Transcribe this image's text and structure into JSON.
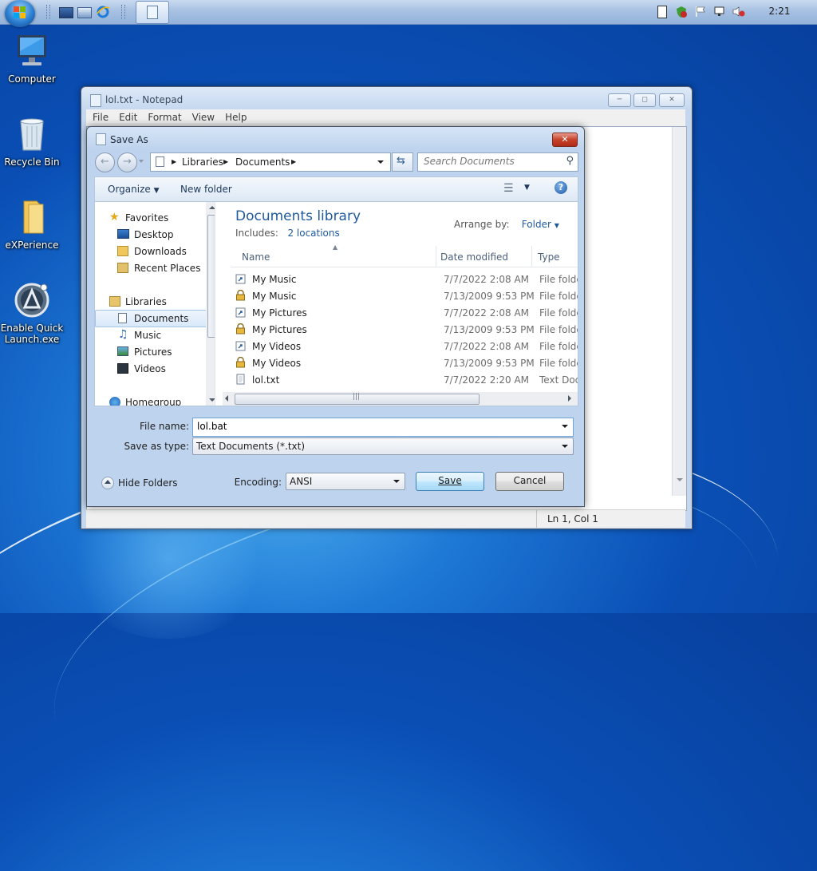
{
  "taskbar": {
    "clock": "2:21"
  },
  "desktop": {
    "icons": [
      {
        "label": "Computer"
      },
      {
        "label": "Recycle Bin"
      },
      {
        "label": "eXPerience"
      },
      {
        "label": "Enable Quick Launch.exe"
      }
    ]
  },
  "notepad": {
    "title": "lol.txt - Notepad",
    "menu": [
      "File",
      "Edit",
      "Format",
      "View",
      "Help"
    ],
    "status": "Ln 1, Col 1"
  },
  "save_dialog": {
    "title": "Save As",
    "breadcrumb": [
      "Libraries",
      "Documents"
    ],
    "search_placeholder": "Search Documents",
    "toolbar": {
      "organize": "Organize",
      "new_folder": "New folder"
    },
    "nav": {
      "favorites": "Favorites",
      "desktop": "Desktop",
      "downloads": "Downloads",
      "recent": "Recent Places",
      "libraries": "Libraries",
      "documents": "Documents",
      "music": "Music",
      "pictures": "Pictures",
      "videos": "Videos",
      "homegroup": "Homegroup"
    },
    "library": {
      "title": "Documents library",
      "includes_label": "Includes:",
      "includes_link": "2 locations",
      "arrange_label": "Arrange by:",
      "arrange_value": "Folder"
    },
    "columns": [
      "Name",
      "Date modified",
      "Type"
    ],
    "files": [
      {
        "name": "My Music",
        "date": "7/7/2022 2:08 AM",
        "type": "File folder"
      },
      {
        "name": "My Music",
        "date": "7/13/2009 9:53 PM",
        "type": "File folder"
      },
      {
        "name": "My Pictures",
        "date": "7/7/2022 2:08 AM",
        "type": "File folder"
      },
      {
        "name": "My Pictures",
        "date": "7/13/2009 9:53 PM",
        "type": "File folder"
      },
      {
        "name": "My Videos",
        "date": "7/7/2022 2:08 AM",
        "type": "File folder"
      },
      {
        "name": "My Videos",
        "date": "7/13/2009 9:53 PM",
        "type": "File folder"
      },
      {
        "name": "lol.txt",
        "date": "7/7/2022 2:20 AM",
        "type": "Text Document"
      }
    ],
    "file_name_label": "File name:",
    "file_name_value": "lol.bat",
    "save_type_label": "Save as type:",
    "save_type_value": "Text Documents (*.txt)",
    "hide_folders": "Hide Folders",
    "encoding_label": "Encoding:",
    "encoding_value": "ANSI",
    "save_button": "Save",
    "cancel_button": "Cancel"
  },
  "colors": {
    "link_blue": "#1e5a9e",
    "close_red": "#c7412b",
    "desktop_blue": "#0a4fb5"
  }
}
